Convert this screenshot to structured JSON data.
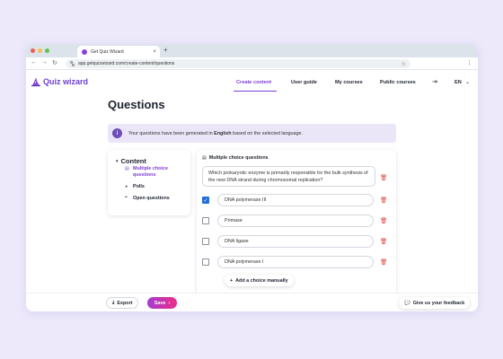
{
  "browser": {
    "tab_title": "Get Quiz Wizard",
    "tab_close": "×",
    "new_tab": "+",
    "url": "app.getquizwizard.com/create-content/questions",
    "back": "←",
    "forward": "→",
    "reload": "↻",
    "star": "☆",
    "menu": "⋮"
  },
  "header": {
    "logo_text": "Quiz wizard",
    "nav": [
      "Create content",
      "User guide",
      "My courses",
      "Public courses"
    ],
    "logout_icon": "⇥",
    "language": "EN",
    "language_chevron": "⌄"
  },
  "page": {
    "title": "Questions",
    "info": {
      "icon": "i",
      "prefix": "Your questions have been generated in ",
      "language": "English",
      "suffix": " based on the selected language."
    }
  },
  "sidebar": {
    "chevron": "▾",
    "title": "Content",
    "items": [
      {
        "icon": "▤",
        "label": "Multiple choice questions"
      },
      {
        "icon": "◕",
        "label": "Polls"
      },
      {
        "icon": "❝",
        "label": "Open questions"
      }
    ]
  },
  "question": {
    "header_icon": "▤",
    "header": "Multiple choice questions",
    "text": "Which prokaryotic enzyme is primarily responsible for the bulk synthesis of the new DNA strand during chromosomal replication?",
    "choices": [
      {
        "label": "DNA polymerase III",
        "checked": true
      },
      {
        "label": "Primase",
        "checked": false
      },
      {
        "label": "DNA ligase",
        "checked": false
      },
      {
        "label": "DNA polymerase I",
        "checked": false
      }
    ],
    "trash_icon": "🗑",
    "check_mark": "✓",
    "add_choice_icon": "+",
    "add_choice": "Add a choice manually"
  },
  "footer": {
    "export_icon": "⤓",
    "export": "Export",
    "save": "Save",
    "save_icon": "›",
    "feedback_icon": "💬",
    "feedback": "Give us your feedback"
  },
  "colors": {
    "accent": "#7b3fd6",
    "save_gradient_start": "#a43bd3",
    "save_gradient_end": "#ec2e84",
    "danger": "#e0463f",
    "checkbox": "#1f6fd8",
    "banner_bg": "#ebe5f8",
    "page_bg": "#ede9fb"
  }
}
